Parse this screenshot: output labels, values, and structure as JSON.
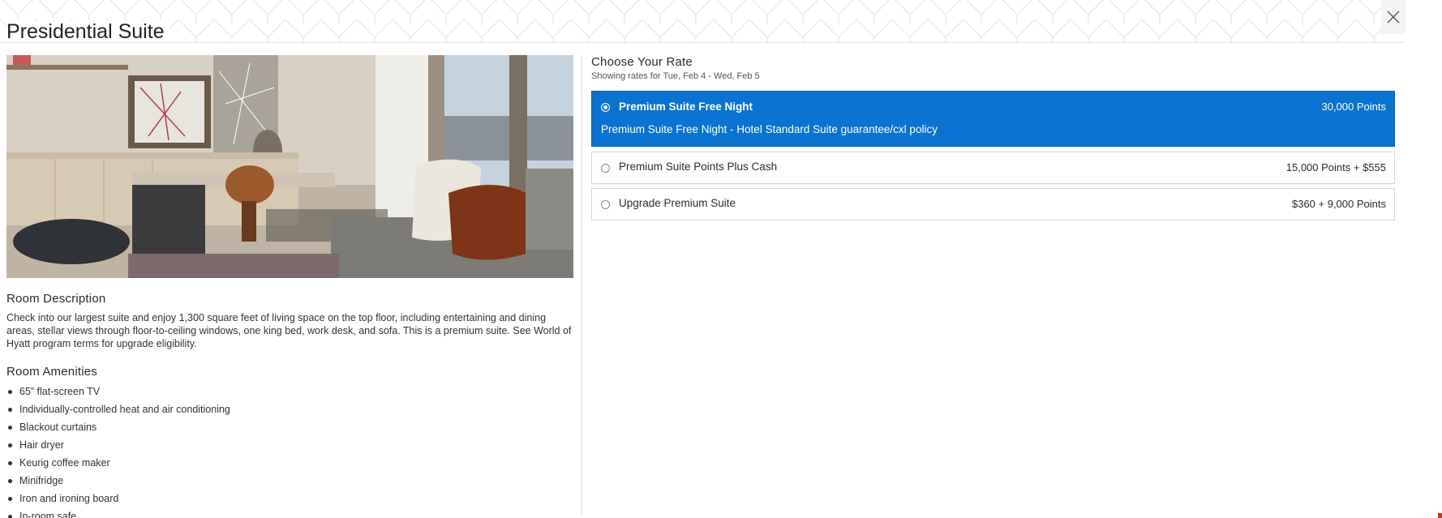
{
  "modal": {
    "title": "Presidential Suite",
    "close_icon": "close-icon"
  },
  "room": {
    "photo_icon": "room-photo",
    "description_heading": "Room Description",
    "description": "Check into our largest suite and enjoy 1,300 square feet of living space on the top floor, including entertaining and dining areas, stellar views through floor-to-ceiling windows, one king bed, work desk, and sofa. This is a premium suite. See World of Hyatt program terms for upgrade eligibility.",
    "amenities_heading": "Room Amenities",
    "amenities": [
      "65” flat-screen TV",
      "Individually-controlled heat and air conditioning",
      "Blackout curtains",
      "Hair dryer",
      "Keurig coffee maker",
      "Minifridge",
      "Iron and ironing board",
      "In-room safe"
    ]
  },
  "rates": {
    "heading": "Choose Your Rate",
    "subheading": "Showing rates for Tue, Feb 4 - Wed, Feb 5",
    "options": [
      {
        "name": "Premium Suite Free Night",
        "price": "30,000 Points",
        "description": "Premium Suite Free Night - Hotel Standard Suite guarantee/cxl policy",
        "selected": true
      },
      {
        "name": "Premium Suite Points Plus Cash",
        "price": "15,000 Points + $555",
        "selected": false
      },
      {
        "name": "Upgrade Premium Suite",
        "price": "$360 + 9,000 Points",
        "selected": false
      }
    ]
  },
  "colors": {
    "selected_rate_bg": "#0a72d1",
    "text": "#2b2b2b"
  }
}
